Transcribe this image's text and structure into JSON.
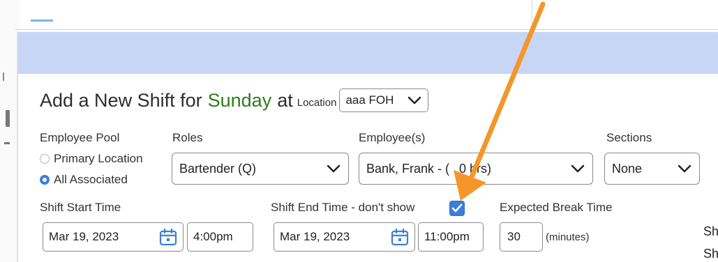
{
  "modal": {
    "title_prefix": "Add a New Shift for",
    "title_day": "Sunday",
    "title_at": "at",
    "location_label": "Location",
    "location_value": "aaa FOH"
  },
  "form": {
    "employee_pool": {
      "label": "Employee Pool",
      "options": [
        "Primary Location",
        "All Associated"
      ],
      "selected": "All Associated"
    },
    "roles": {
      "label": "Roles",
      "value": "Bartender (Q)"
    },
    "employees": {
      "label": "Employee(s)",
      "value": "Bank, Frank - (",
      "value_tail": "0 hrs)"
    },
    "sections": {
      "label": "Sections",
      "value": "None"
    },
    "shift_start": {
      "label": "Shift Start Time",
      "date": "Mar 19, 2023",
      "time": "4:00pm"
    },
    "shift_end": {
      "label": "Shift End Time - don't show",
      "date": "Mar 19, 2023",
      "time": "11:00pm",
      "dont_show_checked": true
    },
    "break": {
      "label": "Expected Break Time",
      "value": "30",
      "unit": "(minutes)"
    },
    "cut_text": [
      "Sh",
      "Sh"
    ]
  },
  "colors": {
    "header_bg": "#c7d6f5",
    "day_green": "#2e7d1c",
    "accent_blue": "#3b7ddd",
    "arrow_orange": "#f5962a"
  },
  "icons": [
    "chevron-down-icon",
    "calendar-icon",
    "checkmark-icon",
    "annotation-arrow"
  ]
}
